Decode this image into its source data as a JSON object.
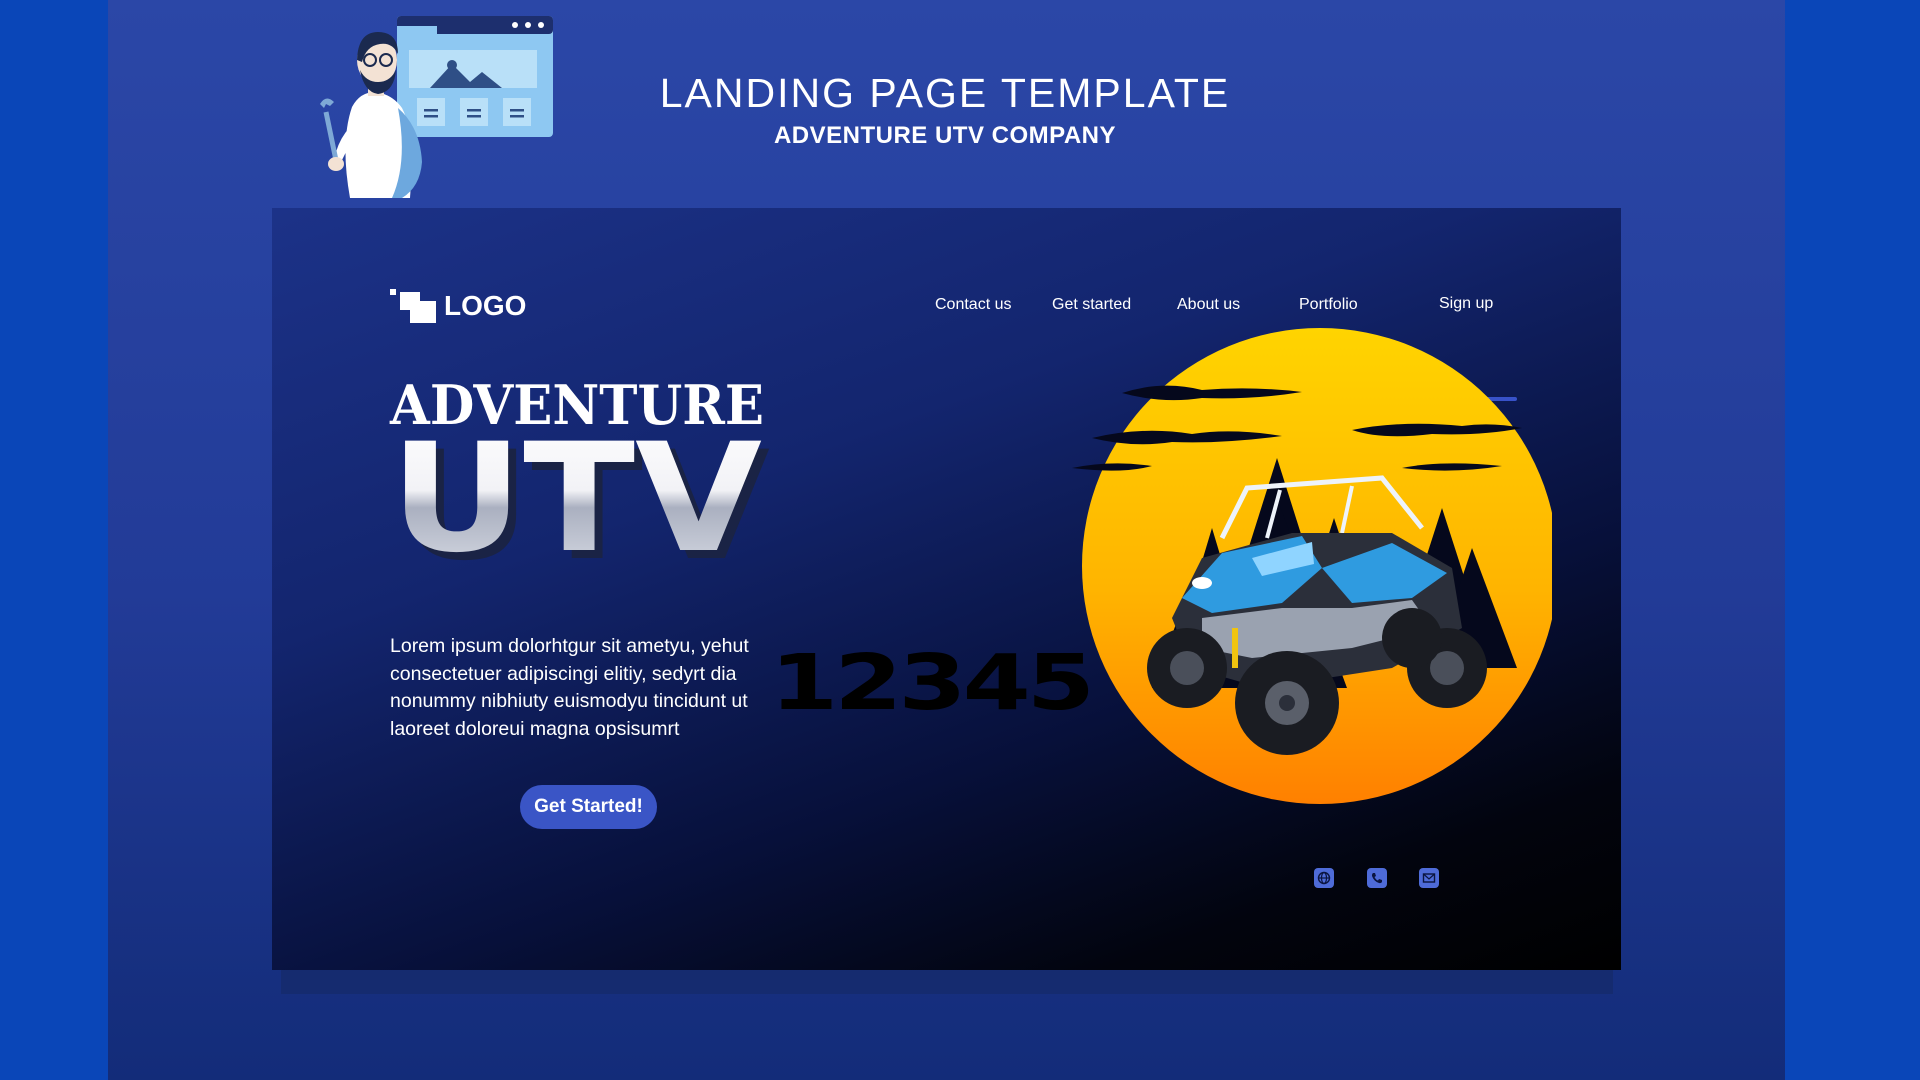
{
  "page": {
    "title": "LANDING PAGE TEMPLATE",
    "subtitle": "ADVENTURE UTV COMPANY"
  },
  "mockup": {
    "logo_text": "LOGO",
    "nav": {
      "contact": "Contact us",
      "get_started": "Get started",
      "about": "About us",
      "portfolio": "Portfolio",
      "sign_up": "Sign up"
    },
    "hero": {
      "line1": "ADVENTURE",
      "line2": "UTV",
      "description": "Lorem ipsum dolorhtgur sit ametyu, yehut consectetuer adipiscingi elitiy, sedyrt dia nonummy nibhiuty euismodyu tincidunt ut laoreet doloreui magna opsisumrt",
      "cta": "Get Started!",
      "overlay_number": "12345"
    },
    "social_icons": [
      "globe-icon",
      "phone-icon",
      "mail-icon"
    ]
  },
  "colors": {
    "background": "#0a46b8",
    "accent": "#3a55c6",
    "sun_top": "#ffd200",
    "sun_bottom": "#ff8a00",
    "utv_body": "#2f9be0"
  }
}
